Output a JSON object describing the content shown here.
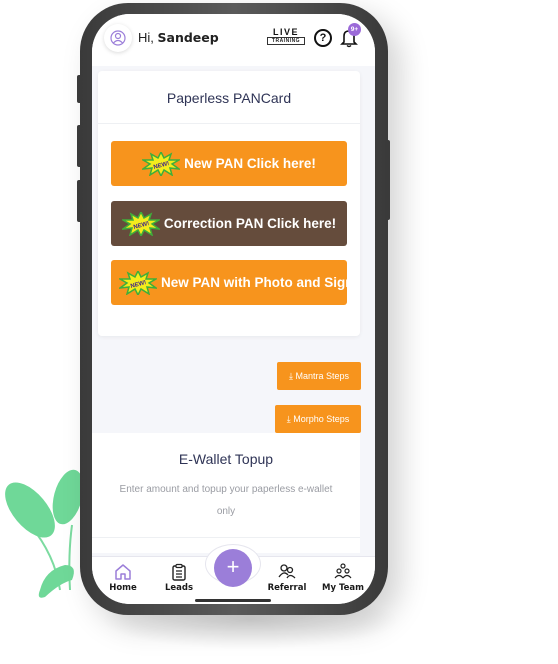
{
  "header": {
    "greeting_prefix": "Hi,",
    "user_name": "Sandeep",
    "live_label": "LIVE",
    "training_label": "TRAINING",
    "help_glyph": "?",
    "notification_badge": "9+",
    "icons": [
      "user-avatar-icon",
      "help-icon",
      "bell-icon"
    ]
  },
  "pancard": {
    "title": "Paperless PANCard",
    "new_badge": "NEW!",
    "buttons": [
      {
        "label": "New PAN Click here!",
        "color": "#f7941d"
      },
      {
        "label": "Correction PAN Click here!",
        "color": "#654c3c"
      },
      {
        "label": "New PAN with Photo and Signature",
        "color": "#f7941d"
      }
    ]
  },
  "steps": {
    "mantra_label": "Mantra Steps",
    "morpho_label": "Morpho Steps",
    "icon": "download-icon"
  },
  "wallet": {
    "title": "E-Wallet Topup",
    "description": "Enter amount and topup your paperless e-wallet only"
  },
  "nav": {
    "items": [
      {
        "label": "Home",
        "icon": "home-icon"
      },
      {
        "label": "Leads",
        "icon": "clipboard-icon"
      },
      {
        "label": "Referral",
        "icon": "referral-icon"
      },
      {
        "label": "My Team",
        "icon": "team-icon"
      }
    ],
    "fab_glyph": "+"
  },
  "colors": {
    "accent": "#9b7ed9",
    "orange": "#f7941d",
    "brown": "#654c3c",
    "title": "#2f3456"
  }
}
